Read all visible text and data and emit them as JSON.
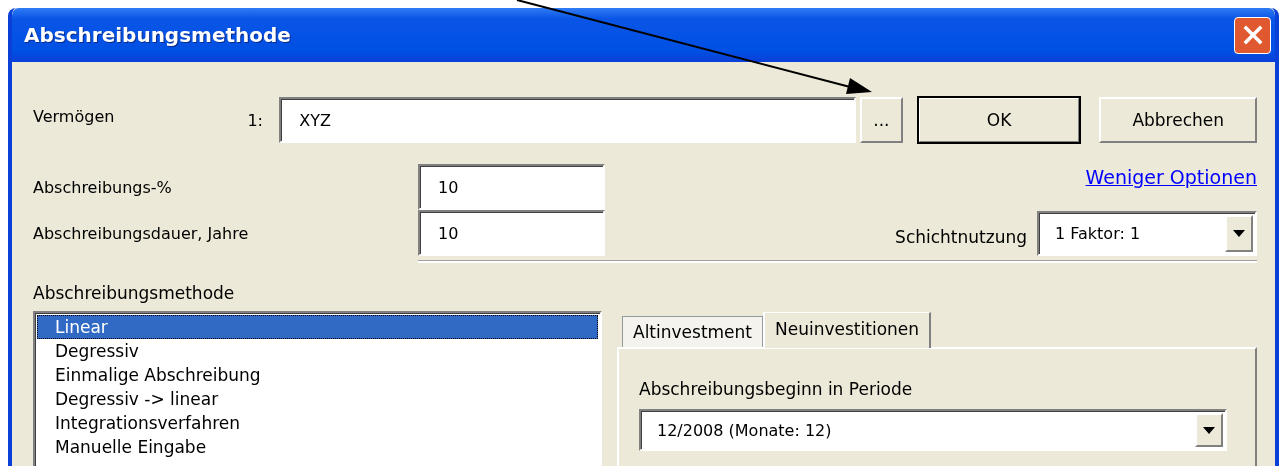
{
  "window": {
    "title": "Abschreibungsmethode"
  },
  "asset": {
    "label": "Vermögen",
    "index": "1:",
    "value": "XYZ",
    "browse_button": "..."
  },
  "buttons": [
    {
      "label": "OK",
      "default": true
    },
    {
      "label": "Abbrechen",
      "default": false
    }
  ],
  "options_link": "Weniger Optionen",
  "fields": [
    {
      "label": "Abschreibungs-%",
      "value": "10"
    },
    {
      "label": "Abschreibungsdauer, Jahre",
      "value": "10"
    }
  ],
  "shift_usage": {
    "label": "Schichtnutzung",
    "value": "1 Faktor: 1"
  },
  "method": {
    "label": "Abschreibungsmethode",
    "items": [
      {
        "label": "Linear",
        "selected": true
      },
      {
        "label": "Degressiv",
        "selected": false
      },
      {
        "label": "Einmalige Abschreibung",
        "selected": false
      },
      {
        "label": "Degressiv -> linear",
        "selected": false
      },
      {
        "label": "Integrationsverfahren",
        "selected": false
      },
      {
        "label": "Manuelle Eingabe",
        "selected": false
      }
    ]
  },
  "tabs": [
    {
      "label": "Altinvestment",
      "selected": false
    },
    {
      "label": "Neuinvestitionen",
      "selected": true
    }
  ],
  "tab_panel": {
    "label": "Abschreibungsbeginn in Periode",
    "value": "12/2008 (Monate: 12)"
  }
}
